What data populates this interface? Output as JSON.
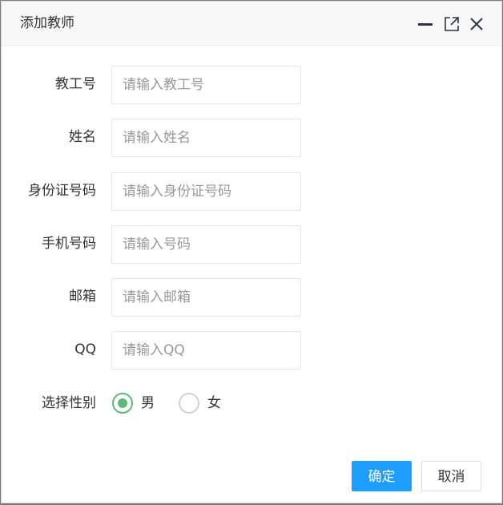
{
  "dialog": {
    "title": "添加教师",
    "controls": {
      "minimize_icon": "minimize-icon",
      "maximize_icon": "maximize-icon",
      "close_icon": "close-icon"
    }
  },
  "form": {
    "fields": [
      {
        "label": "教工号",
        "placeholder": "请输入教工号",
        "value": ""
      },
      {
        "label": "姓名",
        "placeholder": "请输入姓名",
        "value": ""
      },
      {
        "label": "身份证号码",
        "placeholder": "请输入身份证号码",
        "value": ""
      },
      {
        "label": "手机号码",
        "placeholder": "请输入号码",
        "value": ""
      },
      {
        "label": "邮箱",
        "placeholder": "请输入邮箱",
        "value": ""
      },
      {
        "label": "QQ",
        "placeholder": "请输入QQ",
        "value": ""
      }
    ],
    "gender": {
      "label": "选择性别",
      "options": [
        "男",
        "女"
      ],
      "selected": "男"
    }
  },
  "buttons": {
    "confirm": "确定",
    "cancel": "取消"
  },
  "colors": {
    "primary": "#1E9FFF",
    "radio_checked": "#5FB878",
    "titlebar_bg": "#f8f8f8"
  }
}
